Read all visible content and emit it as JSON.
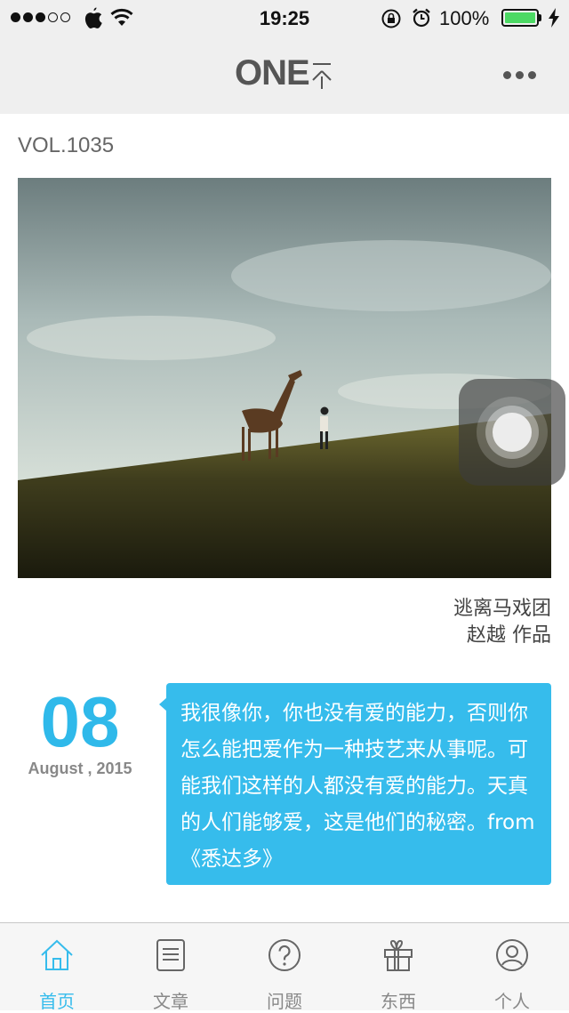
{
  "status_bar": {
    "time": "19:25",
    "battery_percent": "100%",
    "signal_bars_full": 3,
    "signal_bars_total": 5
  },
  "header": {
    "logo_text": "ONE",
    "logo_sub": "一个",
    "more_icon": "more-dots-icon"
  },
  "main": {
    "volume": "VOL.1035",
    "photo_title": "逃离马戏团",
    "photo_author": "赵越 作品",
    "date_day": "08",
    "date_month_year": "August , 2015",
    "quote": "我很像你，你也没有爱的能力，否则你怎么能把爱作为一种技艺来从事呢。可能我们这样的人都没有爱的能力。天真的人们能够爱，这是他们的秘密。from 《悉达多》"
  },
  "tabs": [
    {
      "label": "首页",
      "icon": "home-icon",
      "active": true
    },
    {
      "label": "文章",
      "icon": "article-icon",
      "active": false
    },
    {
      "label": "问题",
      "icon": "question-icon",
      "active": false
    },
    {
      "label": "东西",
      "icon": "gift-icon",
      "active": false
    },
    {
      "label": "个人",
      "icon": "user-icon",
      "active": false
    }
  ],
  "colors": {
    "accent": "#36bcec",
    "date_color": "#2fb9ea",
    "bar_bg": "#efefef",
    "battery_green": "#4cd964"
  }
}
